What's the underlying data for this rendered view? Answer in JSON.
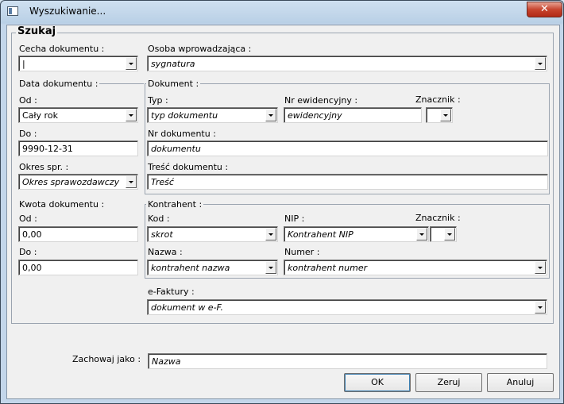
{
  "window": {
    "title": "Wyszukiwanie..."
  },
  "search_group": {
    "title": "Szukaj"
  },
  "cecha": {
    "label": "Cecha dokumentu :",
    "value": "|"
  },
  "osoba": {
    "label": "Osoba wprowadzająca :",
    "placeholder": "sygnatura"
  },
  "data_group": {
    "title": "Data dokumentu :",
    "od_label": "Od :",
    "od_value": "Cały rok",
    "do_label": "Do :",
    "do_value": "9990-12-31",
    "okres_label": "Okres spr. :",
    "okres_placeholder": "Okres sprawozdawczy"
  },
  "dokument_group": {
    "title": "Dokument :",
    "typ_label": "Typ :",
    "typ_placeholder": "typ dokumentu",
    "nr_ewid_label": "Nr ewidencyjny :",
    "nr_ewid_placeholder": "ewidencyjny",
    "znacznik_label": "Znacznik :",
    "nr_dok_label": "Nr dokumentu :",
    "nr_dok_placeholder": "dokumentu",
    "tresc_label": "Treść dokumentu :",
    "tresc_placeholder": "Treść"
  },
  "kwota_group": {
    "title": "Kwota dokumentu :",
    "od_label": "Od :",
    "od_value": "0,00",
    "do_label": "Do :",
    "do_value": "0,00"
  },
  "kontrahent_group": {
    "title": "Kontrahent :",
    "kod_label": "Kod :",
    "kod_placeholder": "skrot",
    "nip_label": "NIP :",
    "nip_placeholder": "Kontrahent NIP",
    "znacznik_label": "Znacznik :",
    "nazwa_label": "Nazwa :",
    "nazwa_placeholder": "kontrahent nazwa",
    "numer_label": "Numer :",
    "numer_placeholder": "kontrahent numer"
  },
  "efaktury": {
    "label": "e-Faktury :",
    "placeholder": "dokument w e-F."
  },
  "save_as": {
    "label": "Zachowaj jako :",
    "placeholder": "Nazwa"
  },
  "buttons": {
    "ok": "OK",
    "reset": "Zeruj",
    "cancel": "Anuluj"
  }
}
